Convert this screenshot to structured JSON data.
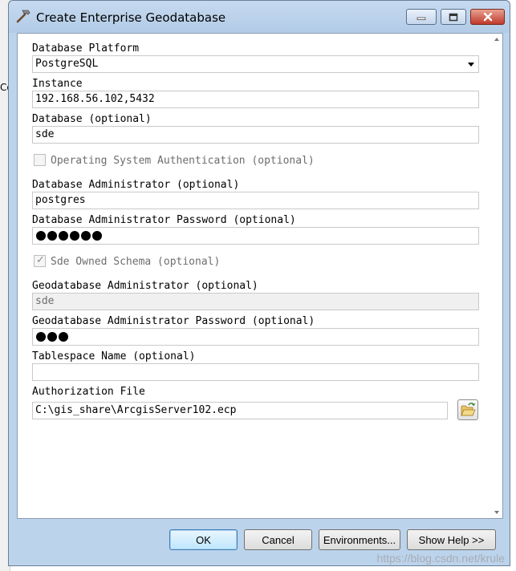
{
  "window": {
    "title": "Create Enterprise Geodatabase",
    "icon": "hammer-icon"
  },
  "background": {
    "partial_text": "Co"
  },
  "form": {
    "db_platform": {
      "label": "Database Platform",
      "value": "PostgreSQL"
    },
    "instance": {
      "label": "Instance",
      "value": "192.168.56.102,5432"
    },
    "database": {
      "label": "Database (optional)",
      "value": "sde"
    },
    "os_auth": {
      "label": "Operating System Authentication (optional)",
      "checked": false,
      "enabled": false
    },
    "db_admin": {
      "label": "Database Administrator (optional)",
      "value": "postgres"
    },
    "db_admin_password": {
      "label": "Database Administrator Password (optional)",
      "masked_length": 6
    },
    "sde_schema": {
      "label": "Sde Owned Schema (optional)",
      "checked": true,
      "enabled": false
    },
    "gdb_admin": {
      "label": "Geodatabase Administrator (optional)",
      "value": "sde",
      "enabled": false
    },
    "gdb_admin_password": {
      "label": "Geodatabase Administrator Password (optional)",
      "masked_length": 3
    },
    "tablespace": {
      "label": "Tablespace Name (optional)",
      "value": ""
    },
    "auth_file": {
      "label": "Authorization File",
      "value": "C:\\gis_share\\ArcgisServer102.ecp"
    }
  },
  "buttons": {
    "ok": "OK",
    "cancel": "Cancel",
    "environments": "Environments...",
    "show_help": "Show Help >>"
  },
  "watermark": "https://blog.csdn.net/krule",
  "colors": {
    "titlebar": "#bcd3ec",
    "close_button": "#c0392b",
    "default_button_border": "#3c7fb1"
  }
}
